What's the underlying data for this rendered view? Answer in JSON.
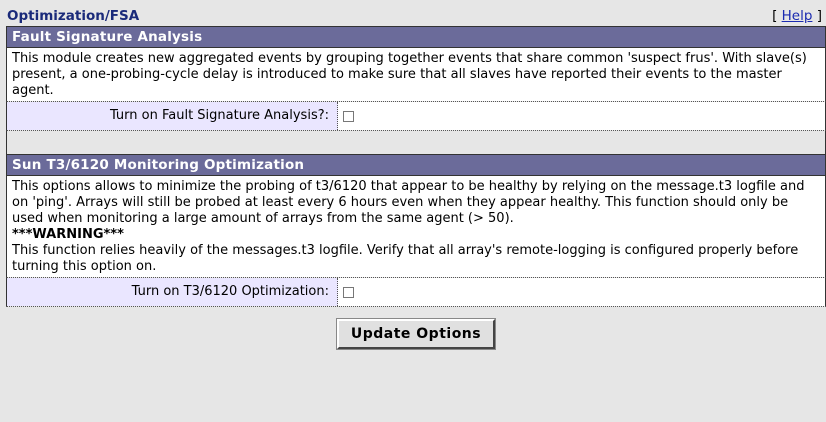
{
  "page": {
    "title": "Optimization/FSA",
    "help_open": "[",
    "help_label": "Help",
    "help_close": "]"
  },
  "fsa": {
    "heading": "Fault Signature Analysis",
    "description": "This module creates new aggregated events by grouping together events that share common 'suspect frus'. With slave(s) present, a one-probing-cycle delay is introduced to make sure that all slaves have reported their events to the master agent.",
    "option_label": "Turn on Fault Signature Analysis?:",
    "option_checked": false
  },
  "t3": {
    "heading": "Sun T3/6120 Monitoring Optimization",
    "description": "This options allows to minimize the probing of t3/6120 that appear to be healthy by relying on the message.t3 logfile and on 'ping'. Arrays will still be probed at least every 6 hours even when they appear healthy. This function should only be used when monitoring a large amount of arrays from the same agent (> 50).",
    "warning": "***WARNING***",
    "warning_text": "This function relies heavily of the messages.t3 logfile. Verify that all array's remote-logging is configured properly before turning this option on.",
    "option_label": "Turn on T3/6120 Optimization:",
    "option_checked": false
  },
  "actions": {
    "update_label": "Update Options"
  }
}
